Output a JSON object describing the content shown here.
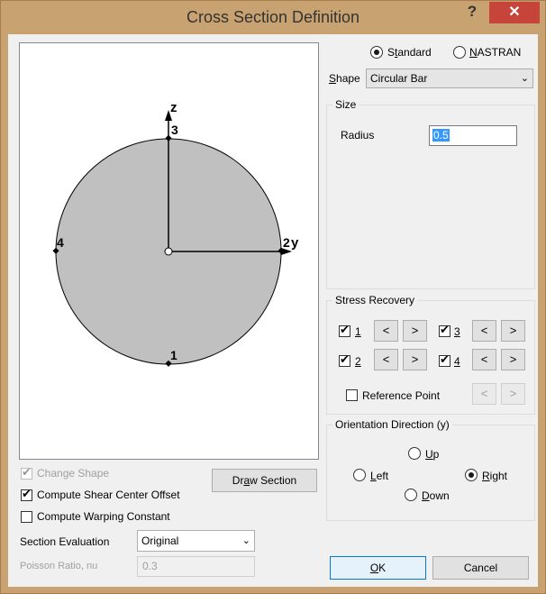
{
  "window": {
    "title": "Cross Section Definition",
    "help_glyph": "?",
    "close_glyph": "✕"
  },
  "preview": {
    "axis_z": "z",
    "axis_y": "y",
    "points": {
      "p1": "1",
      "p2": "2",
      "p3": "3",
      "p4": "4"
    },
    "colors": {
      "disk_fill": "#c0c0c0",
      "outline": "#000000"
    }
  },
  "format": {
    "standard": {
      "pre": "S",
      "ul": "t",
      "post": "andard"
    },
    "nastran": {
      "pre": "",
      "ul": "N",
      "post": "ASTRAN"
    },
    "selected": "Standard"
  },
  "shape": {
    "label_ul": "S",
    "label_rest": "hape",
    "value": "Circular Bar",
    "arrow": "⌄"
  },
  "size": {
    "title": "Size",
    "radius_label": "Radius",
    "radius_value": "0.5"
  },
  "stress": {
    "title": "Stress Recovery",
    "points": [
      {
        "label": "1",
        "checked": true,
        "prev": "<",
        "next": ">"
      },
      {
        "label": "2",
        "checked": true,
        "prev": "<",
        "next": ">"
      },
      {
        "label": "3",
        "checked": true,
        "prev": "<",
        "next": ">"
      },
      {
        "label": "4",
        "checked": true,
        "prev": "<",
        "next": ">"
      }
    ],
    "reference_point": "Reference Point",
    "ref_prev": "<",
    "ref_next": ">"
  },
  "orientation": {
    "title": "Orientation Direction (y)",
    "up": {
      "ul": "U",
      "rest": "p"
    },
    "left": {
      "ul": "L",
      "rest": "eft"
    },
    "right": {
      "ul": "R",
      "rest": "ight"
    },
    "down": {
      "ul": "D",
      "rest": "own"
    },
    "selected": "Right"
  },
  "options": {
    "change_shape": "Change Shape",
    "shear_center": "Compute Shear Center Offset",
    "warping": "Compute Warping Constant",
    "draw_section": {
      "pre": "Dr",
      "ul": "a",
      "post": "w Section"
    }
  },
  "evaluation": {
    "label": "Section Evaluation",
    "value": "Original",
    "arrow": "⌄"
  },
  "poisson": {
    "label": "Poisson Ratio, nu",
    "value": "0.3"
  },
  "buttons": {
    "ok": {
      "ul": "O",
      "rest": "K"
    },
    "cancel": "Cancel"
  },
  "check_glyph": "✔"
}
